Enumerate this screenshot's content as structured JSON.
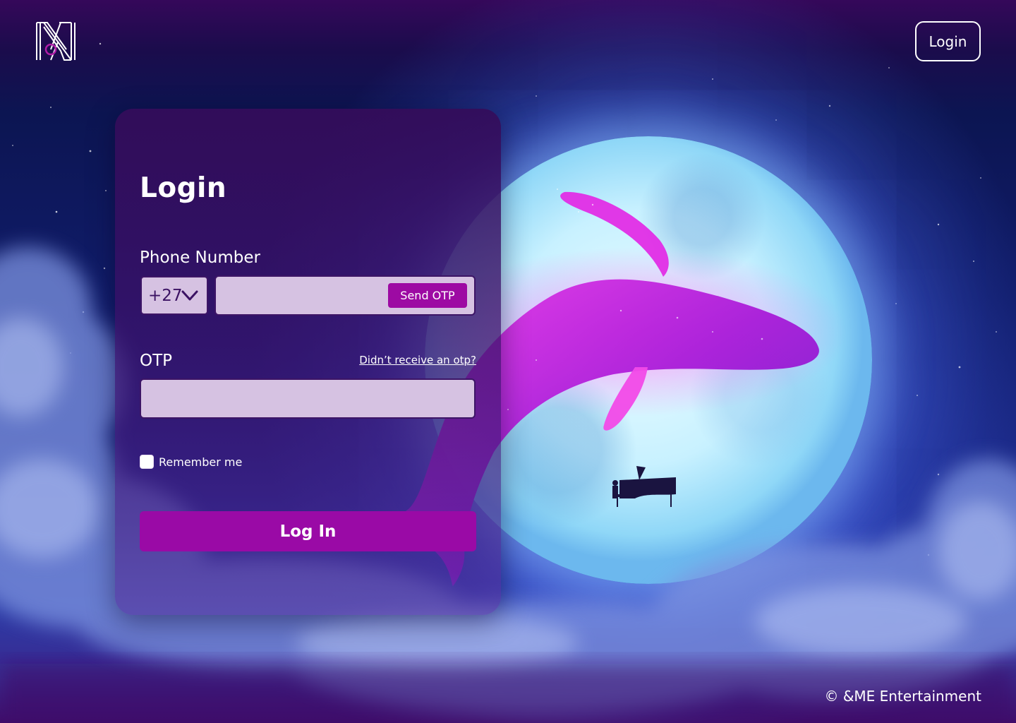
{
  "header": {
    "logo_name": "brand-logo",
    "login_button_label": "Login"
  },
  "login_card": {
    "title": "Login",
    "phone": {
      "label": "Phone Number",
      "country_code": "+27",
      "value": "",
      "send_otp_label": "Send OTP"
    },
    "otp": {
      "label": "OTP",
      "resend_link": "Didn’t receive an otp?",
      "value": ""
    },
    "remember_me": {
      "label": "Remember me",
      "checked": false
    },
    "submit_label": "Log In"
  },
  "footer": {
    "copyright": "© &ME Entertainment"
  },
  "colors": {
    "accent": "#9a0aa6",
    "input_bg": "#d6c2e2",
    "text": "#ffffff",
    "card_bg": "#3a0f62"
  }
}
